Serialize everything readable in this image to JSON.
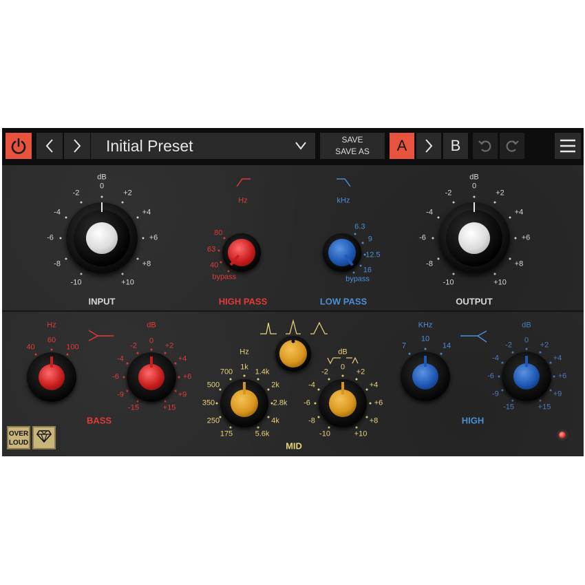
{
  "toolbar": {
    "power_icon": "power-icon",
    "prev_icon": "chevron-left-icon",
    "next_icon": "chevron-right-icon",
    "preset_name": "Initial Preset",
    "save_label": "SAVE",
    "save_as_label": "SAVE AS",
    "a_label": "A",
    "b_label": "B",
    "undo_icon": "undo-icon",
    "redo_icon": "redo-icon",
    "menu_icon": "hamburger-menu-icon",
    "accent_color": "#e8533e"
  },
  "input": {
    "title": "INPUT",
    "unit": "dB",
    "ticks": [
      "0",
      "+2",
      "+4",
      "+6",
      "+8",
      "+10",
      "-10",
      "-8",
      "-6",
      "-4",
      "-2"
    ],
    "knob_color": "#e0e0e0"
  },
  "output": {
    "title": "OUTPUT",
    "unit": "dB",
    "ticks": [
      "0",
      "+2",
      "+4",
      "+6",
      "+8",
      "+10",
      "-10",
      "-8",
      "-6",
      "-4",
      "-2"
    ],
    "knob_color": "#e0e0e0"
  },
  "high_pass": {
    "title": "HIGH PASS",
    "unit": "Hz",
    "ticks": [
      "80",
      "63",
      "40",
      "bypass"
    ],
    "knob_color": "#c81e1e"
  },
  "low_pass": {
    "title": "LOW PASS",
    "unit": "kHz",
    "ticks": [
      "6.3",
      "9",
      "12.5",
      "16",
      "bypass"
    ],
    "knob_color": "#1e58b4"
  },
  "bass": {
    "title": "BASS",
    "freq_unit": "Hz",
    "freq_ticks": [
      "40",
      "60",
      "100"
    ],
    "gain_unit": "dB",
    "gain_ticks": [
      "0",
      "+2",
      "+4",
      "+6",
      "+9",
      "+15",
      "-15",
      "-9",
      "-6",
      "-4",
      "-2"
    ],
    "knob_color": "#c81e1e"
  },
  "mid": {
    "title": "MID",
    "freq_unit": "Hz",
    "freq_ticks": [
      "1k",
      "1.4k",
      "2k",
      "2.8k",
      "4k",
      "5.6k",
      "175",
      "250",
      "350",
      "500",
      "700"
    ],
    "gain_unit": "dB",
    "gain_ticks": [
      "0",
      "+2",
      "+4",
      "+6",
      "+8",
      "+10",
      "-10",
      "-8",
      "-6",
      "-4",
      "-2"
    ],
    "knob_color": "#d8951e"
  },
  "high": {
    "title": "HIGH",
    "freq_unit": "KHz",
    "freq_ticks": [
      "7",
      "10",
      "14"
    ],
    "gain_unit": "dB",
    "gain_ticks": [
      "0",
      "+2",
      "+4",
      "+6",
      "+9",
      "+15",
      "-15",
      "-9",
      "-6",
      "-4",
      "-2"
    ],
    "knob_color": "#1e58b4"
  },
  "logo": {
    "line1": "OVER",
    "line2": "LOUD",
    "badge_icon": "diamond-icon"
  },
  "status": {
    "led_icon": "power-led-icon"
  }
}
